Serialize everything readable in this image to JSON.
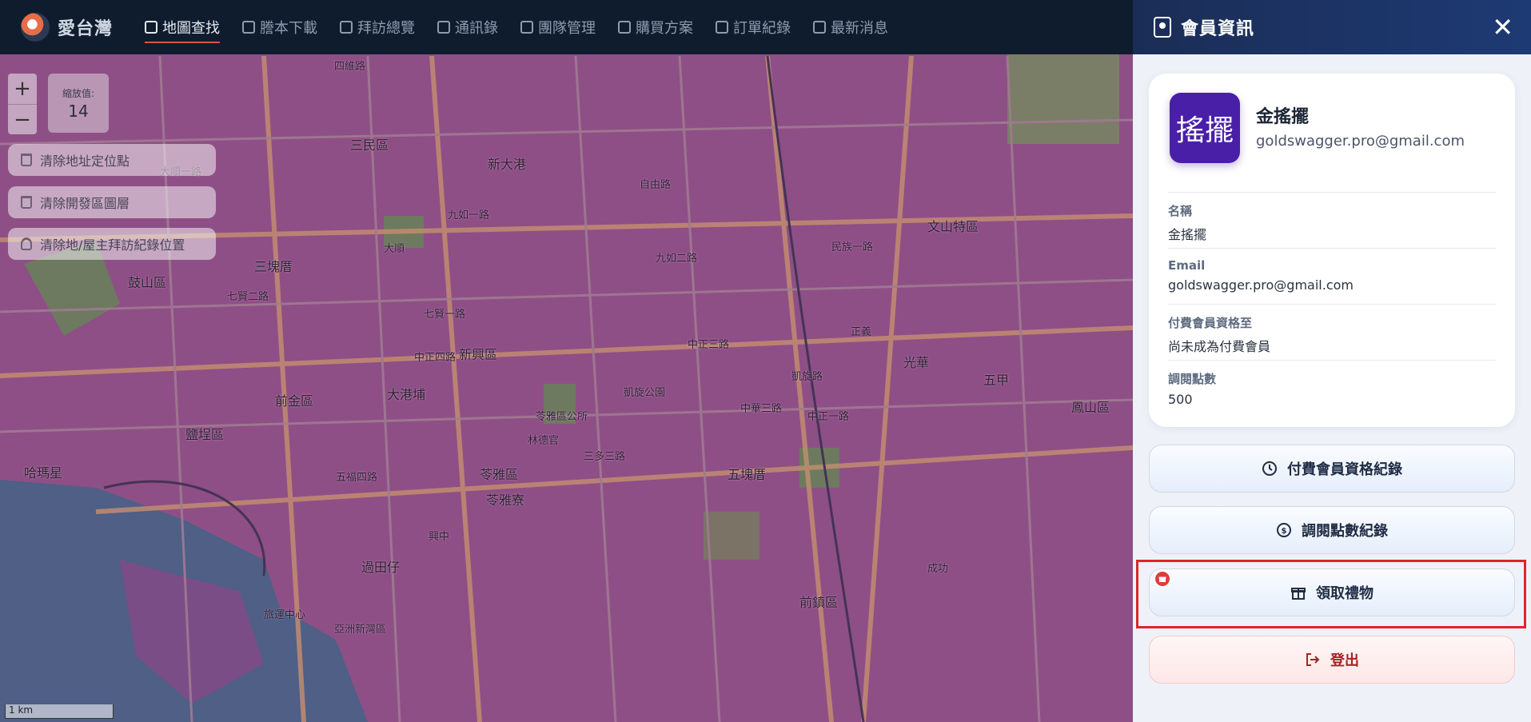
{
  "brand": {
    "name": "愛台灣"
  },
  "nav": [
    {
      "label": "地圖查找",
      "icon": "map-icon",
      "active": true
    },
    {
      "label": "謄本下載",
      "icon": "document-icon"
    },
    {
      "label": "拜訪總覽",
      "icon": "report-icon"
    },
    {
      "label": "通訊錄",
      "icon": "contact-card-icon"
    },
    {
      "label": "團隊管理",
      "icon": "team-icon"
    },
    {
      "label": "購買方案",
      "icon": "wallet-icon"
    },
    {
      "label": "訂單紀錄",
      "icon": "receipt-icon"
    },
    {
      "label": "最新消息",
      "icon": "news-icon"
    }
  ],
  "map": {
    "zoom_label": "縮放值:",
    "zoom_value": "14",
    "zoom_in": "+",
    "zoom_out": "−",
    "clear_buttons": [
      "清除地址定位點",
      "清除開發區圖層",
      "清除地/屋主拜訪紀錄位置"
    ],
    "scale": "1 km",
    "labels": [
      "四維路",
      "大順",
      "三民區",
      "新大港",
      "九如一路",
      "九如二路",
      "三塊厝",
      "七賢一路",
      "新興區",
      "前金區",
      "中正四路",
      "中正三路",
      "大港埔",
      "苓雅區",
      "五塊厝",
      "鼓山區",
      "鹽埕區",
      "哈瑪星",
      "苓雅寮",
      "五福四路",
      "凱旋公園",
      "正義",
      "中正一路",
      "鳳山區",
      "五甲",
      "前鎮區",
      "光華",
      "亞洲新灣區",
      "旅運中心",
      "七賢二路",
      "自由路",
      "大順一路",
      "文山特區",
      "凱旋路",
      "三多三路",
      "民族一路",
      "中華三路",
      "林德官",
      "過田仔",
      "興中",
      "成功",
      "苓雅區公所"
    ]
  },
  "panel": {
    "title": "會員資訊",
    "close": "✕",
    "avatar_text": "搖擺",
    "name": "金搖擺",
    "email": "goldswagger.pro@gmail.com",
    "fields": [
      {
        "label": "名稱",
        "value": "金搖擺"
      },
      {
        "label": "Email",
        "value": "goldswagger.pro@gmail.com"
      },
      {
        "label": "付費會員資格至",
        "value": "尚未成為付費會員"
      },
      {
        "label": "調閱點數",
        "value": "500"
      }
    ],
    "buttons": {
      "membership_history": "付費會員資格紀錄",
      "points_history": "調閱點數紀錄",
      "claim_gift": "領取禮物",
      "logout": "登出"
    }
  },
  "colors": {
    "accent": "#1e3a74",
    "danger": "#e0232d",
    "avatar": "#4a1fa8"
  }
}
